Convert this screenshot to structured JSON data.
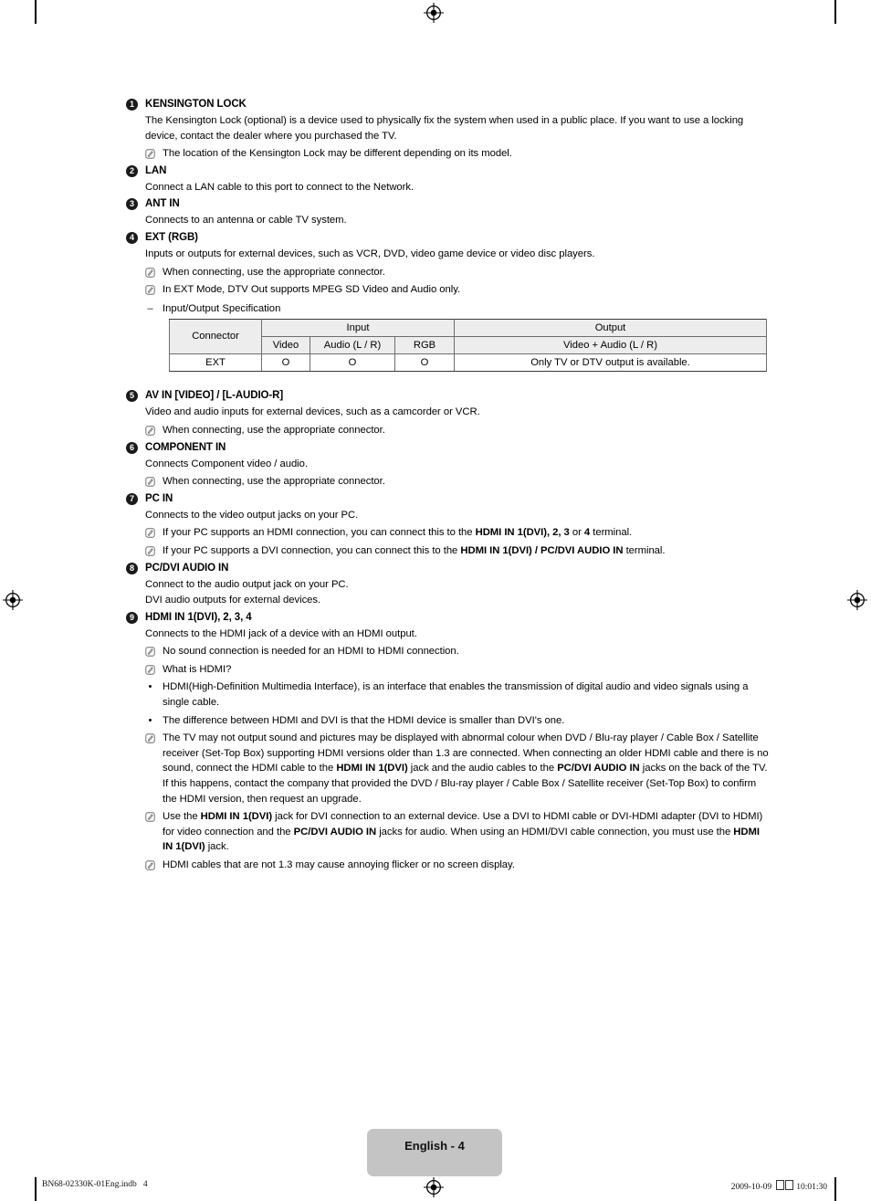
{
  "page": {
    "footer_tab_label": "English - 4",
    "meta_left": "BN68-02330K-01Eng.indb   4",
    "meta_right_date": "2009-10-09",
    "meta_right_time": "10:01:30"
  },
  "sections": [
    {
      "num": "1",
      "title": "KENSINGTON LOCK",
      "paragraphs": [
        "The Kensington Lock (optional) is a device used to physically fix the system when used in a public place. If you want to use a locking device, contact the dealer where you purchased the TV."
      ],
      "notes": [
        "The location of the Kensington Lock may be different depending on its model."
      ]
    },
    {
      "num": "2",
      "title": "LAN",
      "paragraphs": [
        "Connect a LAN cable to this port to connect to the Network."
      ],
      "notes": []
    },
    {
      "num": "3",
      "title": "ANT IN",
      "paragraphs": [
        "Connects to an antenna or cable TV system."
      ],
      "notes": []
    },
    {
      "num": "4",
      "title": "EXT (RGB)",
      "paragraphs": [
        "Inputs or outputs for external devices, such as VCR, DVD, video game device or video disc players."
      ],
      "notes": [
        "When connecting, use the appropriate connector.",
        "In EXT Mode, DTV Out supports MPEG SD Video and Audio only."
      ],
      "dash": "Input/Output Specification"
    },
    {
      "num": "5",
      "title": "AV IN [VIDEO] / [L-AUDIO-R]",
      "paragraphs": [
        "Video and audio inputs for external devices, such as a camcorder or VCR."
      ],
      "notes": [
        "When connecting, use the appropriate connector."
      ]
    },
    {
      "num": "6",
      "title": "COMPONENT IN",
      "paragraphs": [
        "Connects Component video / audio."
      ],
      "notes": [
        "When connecting, use the appropriate connector."
      ]
    },
    {
      "num": "7",
      "title": "PC IN",
      "paragraphs": [
        "Connects to the video output jacks on your PC."
      ],
      "notes": []
    },
    {
      "num": "8",
      "title": "PC/DVI AUDIO IN",
      "paragraphs": [
        "Connect to the audio output jack on your PC.",
        "DVI audio outputs for external devices."
      ],
      "notes": []
    },
    {
      "num": "9",
      "title": "HDMI IN 1(DVI), 2, 3, 4",
      "paragraphs": [
        "Connects to the HDMI jack of a device with an HDMI output."
      ],
      "notes": [
        "No sound connection is needed for an HDMI to HDMI connection.",
        "What is HDMI?"
      ]
    }
  ],
  "pc_in_notes": {
    "note1_pre": "If your PC supports an HDMI connection, you can connect this to the ",
    "note1_b1": "HDMI IN 1(DVI), 2, 3",
    "note1_mid": " or ",
    "note1_b2": "4",
    "note1_post": " terminal.",
    "note2_pre": "If your PC supports a DVI connection, you can connect this to the ",
    "note2_b1": "HDMI IN 1(DVI) / PC/DVI AUDIO IN",
    "note2_post": " terminal."
  },
  "hdmi_bullets": [
    "HDMI(High-Definition Multimedia Interface), is an interface that enables the transmission of digital audio and video signals using a single cable.",
    "The difference between HDMI and DVI is that the HDMI device is smaller than DVI's one."
  ],
  "hdmi_long_notes": {
    "note_a_p1": "The TV may not output sound and pictures may be displayed with abnormal colour when DVD / Blu-ray player / Cable Box / Satellite receiver (Set-Top Box) supporting HDMI versions older than 1.3 are connected. When connecting an older HDMI cable and there is no sound, connect the HDMI cable to the ",
    "note_a_b1": "HDMI IN 1(DVI)",
    "note_a_p2": " jack and the audio cables to the ",
    "note_a_b2": "PC/DVI AUDIO IN",
    "note_a_p3": " jacks on the back of the TV. If this happens, contact the company that provided the DVD / Blu-ray player / Cable Box / Satellite receiver (Set-Top Box) to confirm the HDMI version, then request an upgrade.",
    "note_b_p1": "Use the ",
    "note_b_b1": "HDMI IN 1(DVI)",
    "note_b_p2": " jack for DVI connection to an external device. Use a DVI to HDMI cable or DVI-HDMI adapter (DVI to HDMI) for video connection and the ",
    "note_b_b2": "PC/DVI AUDIO IN",
    "note_b_p3": " jacks for audio. When using an HDMI/DVI cable connection, you must use the ",
    "note_b_b3": "HDMI IN 1(DVI)",
    "note_b_p4": " jack.",
    "note_c": "HDMI cables that are not 1.3 may cause annoying flicker or no screen display."
  },
  "spec_table": {
    "group_headers": [
      "Connector",
      "Input",
      "Output"
    ],
    "sub_headers": [
      "Video",
      "Audio (L / R)",
      "RGB",
      "Video + Audio (L / R)"
    ],
    "rows": [
      {
        "connector": "EXT",
        "video": "O",
        "audio": "O",
        "rgb": "O",
        "output": "Only TV or DTV output is available."
      }
    ]
  }
}
